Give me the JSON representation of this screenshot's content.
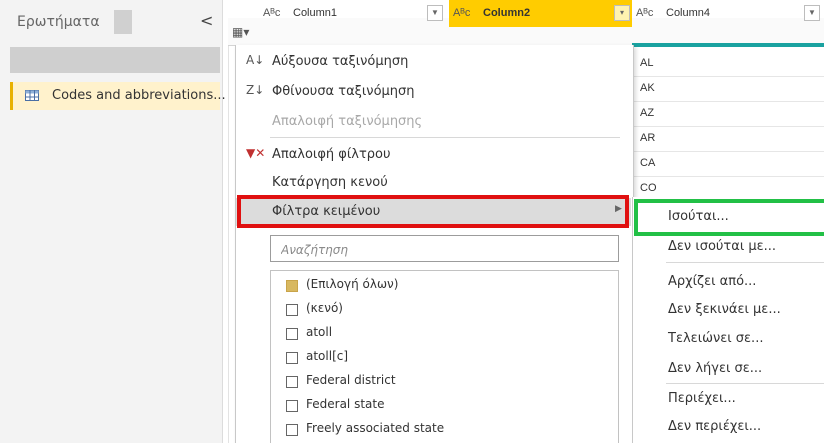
{
  "queries_pane": {
    "title": "Ερωτήματα",
    "collapse_glyph": "<",
    "items": [
      {
        "label": "Codes and abbreviations..."
      }
    ]
  },
  "grid": {
    "columns": [
      {
        "type_glyph": "Aᴮc",
        "name": "Column1"
      },
      {
        "type_glyph": "Aᴮc",
        "name": "Column2"
      },
      {
        "type_glyph": "Aᴮc",
        "name": "Column4"
      }
    ],
    "column4_values": [
      "AL",
      "AK",
      "AZ",
      "AR",
      "CA",
      "CO"
    ],
    "accent_color": "#ffcc00",
    "quality_bar_color": "#1aa2a0"
  },
  "filter_menu": {
    "items": [
      {
        "label": "Αύξουσα ταξινόμηση",
        "icon": "sort-ascending-icon"
      },
      {
        "label": "Φθίνουσα ταξινόμηση",
        "icon": "sort-descending-icon"
      },
      {
        "label": "Απαλοιφή ταξινόμησης",
        "disabled": true
      },
      {
        "label": "Απαλοιφή φίλτρου",
        "icon": "clear-filter-icon"
      },
      {
        "label": "Κατάργηση κενού"
      },
      {
        "label": "Φίλτρα κειμένου",
        "submenu": true
      }
    ],
    "search_placeholder": "Αναζήτηση",
    "values": [
      {
        "label": "(Επιλογή όλων)",
        "state": "partial"
      },
      {
        "label": "(κενό)",
        "state": "unchecked"
      },
      {
        "label": "atoll",
        "state": "unchecked"
      },
      {
        "label": "atoll[c]",
        "state": "unchecked"
      },
      {
        "label": "Federal district",
        "state": "unchecked"
      },
      {
        "label": "Federal state",
        "state": "unchecked"
      },
      {
        "label": "Freely associated state",
        "state": "unchecked"
      }
    ],
    "highlight_color": "#e01010"
  },
  "text_filters_submenu": {
    "items": [
      "Ισούται...",
      "Δεν ισούται με...",
      "Αρχίζει από...",
      "Δεν ξεκινάει με...",
      "Τελειώνει σε...",
      "Δεν λήγει σε...",
      "Περιέχει...",
      "Δεν περιέχει..."
    ],
    "highlight_color": "#22c046"
  }
}
